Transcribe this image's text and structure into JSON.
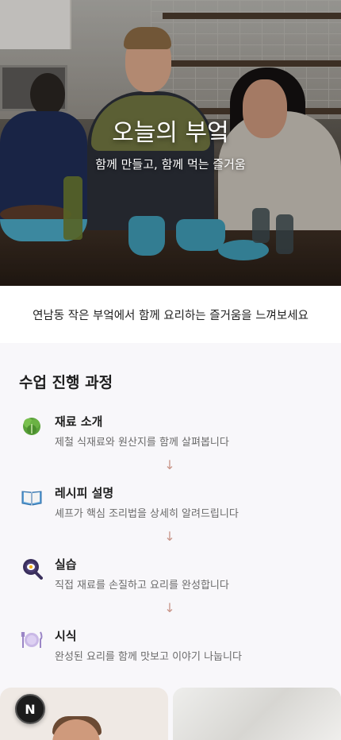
{
  "hero": {
    "title": "오늘의 부엌",
    "subtitle": "함께 만들고, 함께 먹는 즐거움"
  },
  "intro": {
    "text": "연남동 작은 부엌에서 함께 요리하는 즐거움을 느껴보세요"
  },
  "process": {
    "title": "수업 진행 과정",
    "steps": [
      {
        "icon": "lettuce-icon",
        "title": "재료 소개",
        "description": "제철 식재료와 원산지를 함께 살펴봅니다"
      },
      {
        "icon": "book-icon",
        "title": "레시피 설명",
        "description": "셰프가 핵심 조리법을 상세히 알려드립니다"
      },
      {
        "icon": "frying-pan-icon",
        "title": "실습",
        "description": "직접 재료를 손질하고 요리를 완성합니다"
      },
      {
        "icon": "plate-cutlery-icon",
        "title": "시식",
        "description": "완성된 요리를 함께 맛보고 이야기 나눕니다"
      }
    ],
    "arrow": "↓"
  },
  "fab": {
    "label": "N"
  },
  "colors": {
    "accent": "#c9968a",
    "background": "#f8f7fa"
  }
}
